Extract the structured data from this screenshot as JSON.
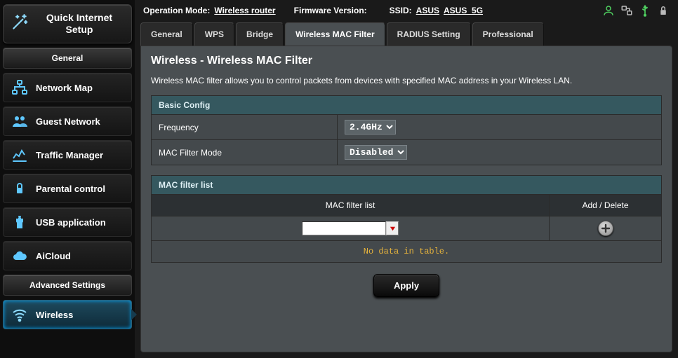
{
  "qis": {
    "label": "Quick Internet Setup"
  },
  "section_general_label": "General",
  "section_advanced_label": "Advanced Settings",
  "sidebar": {
    "items": [
      {
        "id": "network-map",
        "label": "Network Map"
      },
      {
        "id": "guest-network",
        "label": "Guest Network"
      },
      {
        "id": "traffic-manager",
        "label": "Traffic Manager"
      },
      {
        "id": "parental-control",
        "label": "Parental control"
      },
      {
        "id": "usb-application",
        "label": "USB application"
      },
      {
        "id": "aicloud",
        "label": "AiCloud"
      }
    ],
    "adv": [
      {
        "id": "wireless",
        "label": "Wireless"
      }
    ]
  },
  "topbar": {
    "op_mode_label": "Operation Mode:",
    "op_mode_value": "Wireless router",
    "fw_label": "Firmware Version:",
    "ssid_label": "SSID:",
    "ssid_value1": "ASUS",
    "ssid_value2": "ASUS_5G"
  },
  "tabs": [
    {
      "id": "general",
      "label": "General"
    },
    {
      "id": "wps",
      "label": "WPS"
    },
    {
      "id": "bridge",
      "label": "Bridge"
    },
    {
      "id": "macfilter",
      "label": "Wireless MAC Filter"
    },
    {
      "id": "radius",
      "label": "RADIUS Setting"
    },
    {
      "id": "professional",
      "label": "Professional"
    }
  ],
  "active_tab": "macfilter",
  "page": {
    "title": "Wireless - Wireless MAC Filter",
    "description": "Wireless MAC filter allows you to control packets from devices with specified MAC address in your Wireless LAN.",
    "basic_config_label": "Basic Config",
    "frequency_label": "Frequency",
    "frequency_value": "2.4GHz",
    "mode_label": "MAC Filter Mode",
    "mode_value": "Disabled",
    "list_section_label": "MAC filter list",
    "col_mac_label": "MAC filter list",
    "col_action_label": "Add / Delete",
    "mac_input_value": "",
    "no_data_label": "No data in table.",
    "apply_label": "Apply"
  },
  "colors": {
    "accent_cyan": "#0af",
    "section_teal": "#35585f",
    "warn_amber": "#e6b33c"
  }
}
